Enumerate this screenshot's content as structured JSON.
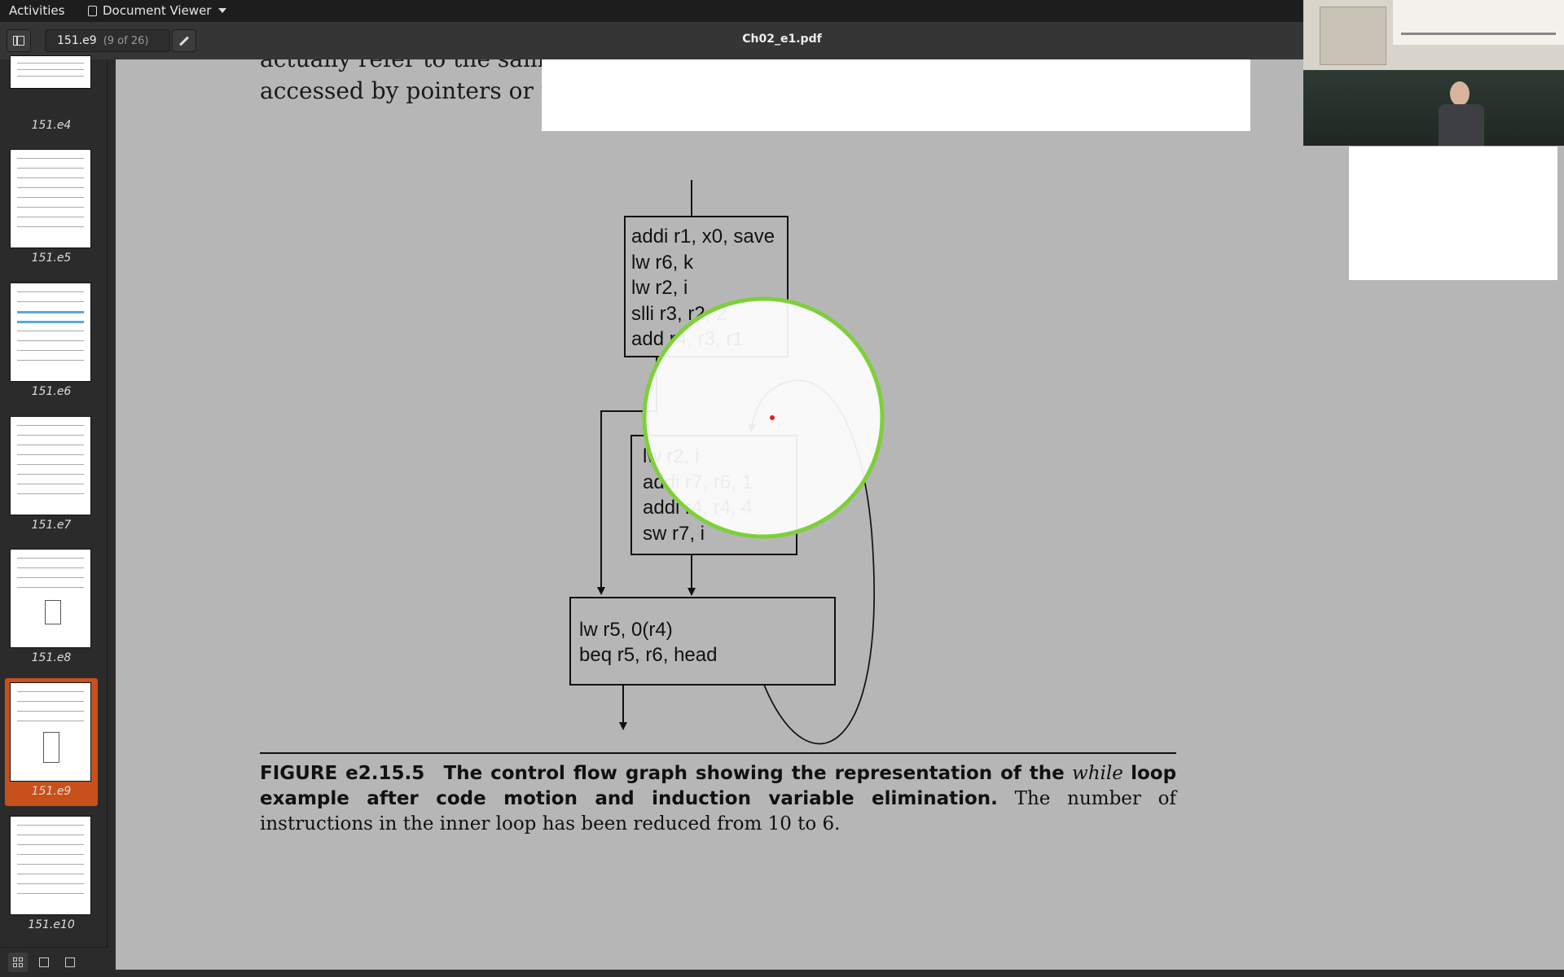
{
  "topbar": {
    "activities": "Activities",
    "app_name": "Document Viewer"
  },
  "header": {
    "page_entry": "151.e9",
    "page_count": "(9 of 26)",
    "title": "Ch02_e1.pdf"
  },
  "sidebar": {
    "thumbnails": [
      {
        "label": "151.e4"
      },
      {
        "label": "151.e5"
      },
      {
        "label": "151.e6"
      },
      {
        "label": "151.e7"
      },
      {
        "label": "151.e8"
      },
      {
        "label": "151.e9",
        "selected": true
      },
      {
        "label": "151.e10"
      }
    ]
  },
  "page": {
    "text_line1": "actually refer to the same memory location, which could happen if they were",
    "text_line2": "accessed by pointers or reference parameters.",
    "cfg": {
      "block1": [
        "addi r1, x0, save",
        "lw r6, k",
        "lw r2, i",
        "slli r3, r2, 2",
        "add r4, r3, r1"
      ],
      "block2": [
        "lw r2, i",
        "addi r7, r6, 1",
        "addi r4, r4, 4",
        "sw r7, i"
      ],
      "block3": [
        "lw r5, 0(r4)",
        "beq r5, r6, head"
      ]
    },
    "caption": {
      "fignum": "FIGURE e2.15.5",
      "bold_part1": "The control flow graph showing the representation of the",
      "italic_word": "while",
      "bold_part2": "loop example after code motion and induction variable elimination.",
      "rest": "The number of instructions in the inner loop has been reduced from 10 to 6."
    }
  },
  "colors": {
    "selection": "#c8501b",
    "magnifier_ring": "#7ed03a",
    "page_bg": "#b6b6b6"
  }
}
